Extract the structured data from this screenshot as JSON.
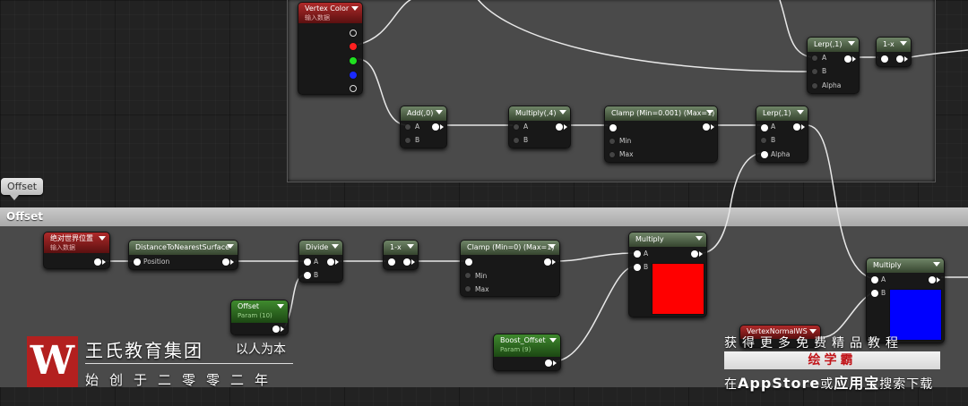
{
  "comments": {
    "bottom_tab": "Offset",
    "bottom_title": "Offset"
  },
  "nodes": {
    "vertex_color": {
      "title": "Vertex Color",
      "subtitle": "输入数据"
    },
    "lerp_top": {
      "title": "Lerp(,1)",
      "pins": [
        "A",
        "B",
        "Alpha"
      ]
    },
    "one_minus_top": {
      "title": "1-x"
    },
    "add": {
      "title": "Add(,0)",
      "pins": [
        "A",
        "B"
      ]
    },
    "multiply_4": {
      "title": "Multiply(,4)",
      "pins": [
        "A",
        "B"
      ]
    },
    "clamp_top": {
      "title": "Clamp (Min=0.001) (Max=1)",
      "pins": [
        "Min",
        "Max"
      ]
    },
    "lerp_mid": {
      "title": "Lerp(,1)",
      "pins": [
        "A",
        "B",
        "Alpha"
      ]
    },
    "abs_world_pos": {
      "title": "绝对世界位置",
      "subtitle": "输入数据"
    },
    "distance_surface": {
      "title": "DistanceToNearestSurface",
      "pins": [
        "Position"
      ]
    },
    "divide": {
      "title": "Divide",
      "pins": [
        "A",
        "B"
      ]
    },
    "one_minus_bottom": {
      "title": "1-x"
    },
    "clamp_bottom": {
      "title": "Clamp (Min=0) (Max=1)",
      "pins": [
        "Min",
        "Max"
      ]
    },
    "multiply_red": {
      "title": "Multiply",
      "pins": [
        "A",
        "B"
      ],
      "swatch": "#ff0000"
    },
    "multiply_blue": {
      "title": "Multiply",
      "pins": [
        "A",
        "B"
      ],
      "swatch": "#0000ff"
    },
    "offset_param": {
      "title": "Offset",
      "subtitle": "Param (10)"
    },
    "boost_offset": {
      "title": "Boost_Offset",
      "subtitle": "Param (9)"
    },
    "vertex_normal": {
      "title": "VertexNormalWS"
    }
  },
  "watermark": {
    "logo_letter": "W",
    "name": "王氏教育集团",
    "slogan": "以人为本",
    "since": "始创于二零零二年"
  },
  "promo": {
    "line1": "获得更多免费精品教程",
    "line2": "绘学霸",
    "line3_pre": "在",
    "line3_store": "AppStore",
    "line3_mid": "或",
    "line3_bao": "应用宝",
    "line3_post": "搜索下载"
  },
  "colors": {
    "red_pin": "#ff2020",
    "green_pin": "#20e020",
    "blue_pin": "#1a2aff",
    "red_swatch": "#ff0000",
    "blue_swatch": "#0000ff"
  }
}
